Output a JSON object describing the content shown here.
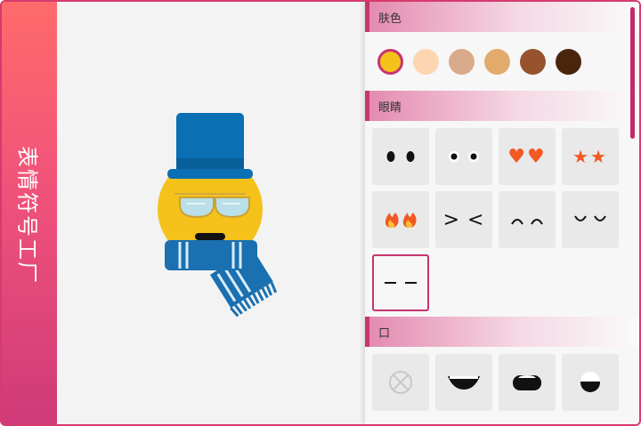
{
  "sidebar": {
    "title": "表情符号工厂"
  },
  "panel": {
    "skin": {
      "label": "肤色",
      "colors": [
        "#f4c21b",
        "#fdd5b1",
        "#d9aa89",
        "#e2ab6c",
        "#96532d",
        "#4a250d"
      ],
      "selected_index": 0
    },
    "eyes": {
      "label": "眼睛",
      "options": [
        {
          "name": "dot-eyes"
        },
        {
          "name": "white-eyes"
        },
        {
          "name": "heart-eyes",
          "glyph": "♥♥"
        },
        {
          "name": "star-eyes",
          "glyph": "★★"
        },
        {
          "name": "fire-eyes",
          "glyph": "🔥🔥"
        },
        {
          "name": "squint-eyes",
          "glyph": "> <"
        },
        {
          "name": "happy-arc-eyes",
          "glyph": "⌒⌒"
        },
        {
          "name": "closed-eyes",
          "glyph": "◡◡"
        },
        {
          "name": "dash-eyes",
          "glyph": "– –"
        }
      ],
      "selected_index": 8
    },
    "mouth": {
      "label": "口",
      "options": [
        {
          "name": "no-mouth"
        },
        {
          "name": "wide-grin-mouth"
        },
        {
          "name": "open-mouth"
        },
        {
          "name": "round-mouth"
        }
      ]
    }
  },
  "colors": {
    "accent": "#c7356f",
    "hat": "#0a6fb3",
    "scarf": "#1a70b0",
    "face": "#f4c21b"
  }
}
